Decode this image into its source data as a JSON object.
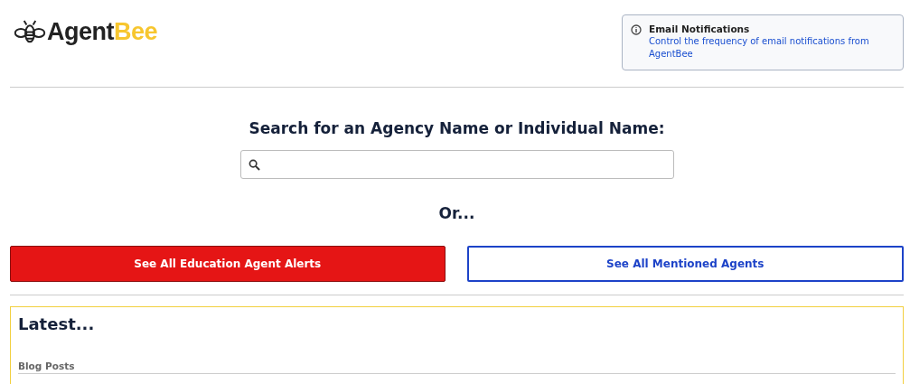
{
  "logo": {
    "text": "Agent",
    "accent": "Bee"
  },
  "notification": {
    "title": "Email Notifications",
    "link": "Control the frequency of email notifications from AgentBee"
  },
  "search": {
    "heading": "Search for an Agency Name or Individual Name:"
  },
  "or_text": "Or...",
  "buttons": [
    {
      "label": "See All Education Agent Alerts",
      "kind": "primary"
    },
    {
      "label": "See All Mentioned Agents",
      "kind": "outline"
    }
  ],
  "latest": {
    "title": "Latest...",
    "section": "Blog Posts"
  }
}
